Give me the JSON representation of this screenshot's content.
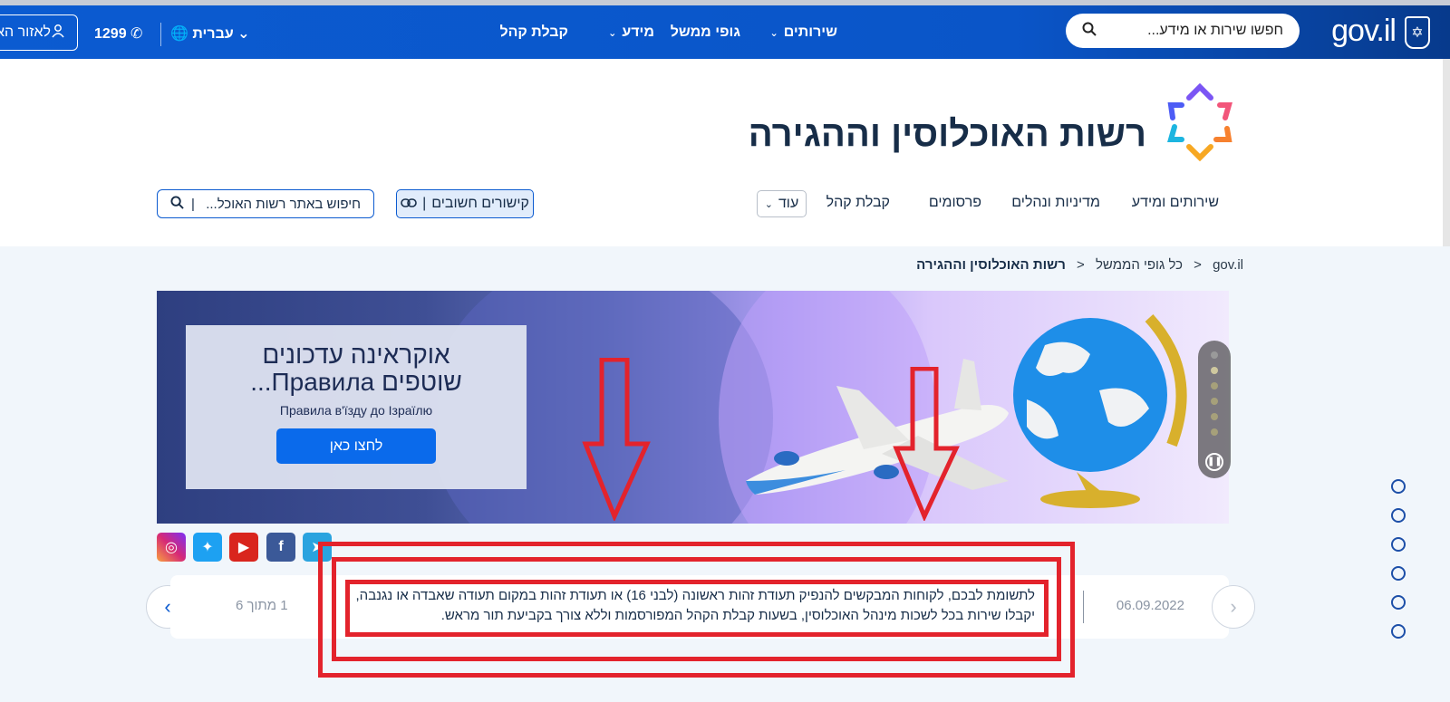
{
  "topbar": {
    "logo": "gov.il",
    "search_placeholder": "חפשו שירות או מידע...",
    "nav": {
      "services": "שירותים",
      "gov_bodies": "גופי ממשל",
      "info": "מידע",
      "public_reception": "קבלת קהל"
    },
    "language": "עברית",
    "phone": "1299",
    "personal_area": "לאזור הא"
  },
  "office": {
    "title": "רשות האוכלוסין וההגירה",
    "nav": [
      "שירותים ומידע",
      "מדיניות ונהלים",
      "פרסומים",
      "קבלת קהל"
    ],
    "more": "עוד",
    "important_links": "קישורים חשובים",
    "site_search_placeholder": "חיפוש באתר רשות האוכל..."
  },
  "breadcrumb": {
    "home": "gov.il",
    "all_bodies": "כל גופי הממשל",
    "current": "רשות האוכלוסין וההגירה"
  },
  "banner": {
    "title_line1": "אוקראינה עדכונים",
    "title_line2": "שוטפים Правила...",
    "subtitle": "Правила в'їзду до Ізраїлю",
    "cta": "לחצו כאן"
  },
  "news": {
    "text": "לתשומת לבכם, לקוחות המבקשים להנפיק תעודת זהות ראשונה (לבני 16) או תעודת זהות במקום תעודה שאבדה או נגנבה, יקבלו שירות בכל לשכות מינהל האוכלוסין, בשעות קבלת הקהל המפורסמות וללא צורך בקביעת תור מראש.",
    "date": "06.09.2022",
    "counter": "1 מתוך 6"
  },
  "colors": {
    "topbar": "#0b5bd1",
    "annotation": "#e3232c",
    "title": "#172d48",
    "cta": "#0a6aeb"
  }
}
